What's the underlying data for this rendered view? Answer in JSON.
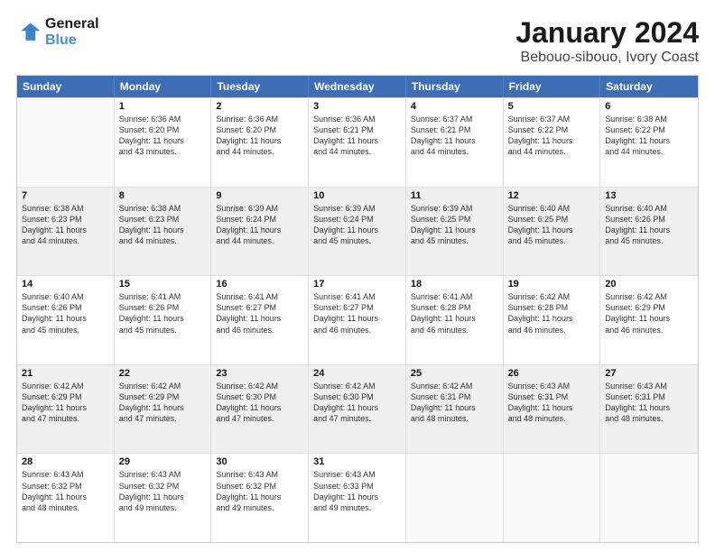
{
  "header": {
    "logo_line1": "General",
    "logo_line2": "Blue",
    "title": "January 2024",
    "subtitle": "Bebouo-sibouo, Ivory Coast"
  },
  "weekdays": [
    "Sunday",
    "Monday",
    "Tuesday",
    "Wednesday",
    "Thursday",
    "Friday",
    "Saturday"
  ],
  "weeks": [
    [
      {
        "day": "",
        "info": "",
        "empty": true
      },
      {
        "day": "1",
        "info": "Sunrise: 6:36 AM\nSunset: 6:20 PM\nDaylight: 11 hours\nand 43 minutes."
      },
      {
        "day": "2",
        "info": "Sunrise: 6:36 AM\nSunset: 6:20 PM\nDaylight: 11 hours\nand 44 minutes."
      },
      {
        "day": "3",
        "info": "Sunrise: 6:36 AM\nSunset: 6:21 PM\nDaylight: 11 hours\nand 44 minutes."
      },
      {
        "day": "4",
        "info": "Sunrise: 6:37 AM\nSunset: 6:21 PM\nDaylight: 11 hours\nand 44 minutes."
      },
      {
        "day": "5",
        "info": "Sunrise: 6:37 AM\nSunset: 6:22 PM\nDaylight: 11 hours\nand 44 minutes."
      },
      {
        "day": "6",
        "info": "Sunrise: 6:38 AM\nSunset: 6:22 PM\nDaylight: 11 hours\nand 44 minutes."
      }
    ],
    [
      {
        "day": "7",
        "info": "Sunrise: 6:38 AM\nSunset: 6:23 PM\nDaylight: 11 hours\nand 44 minutes."
      },
      {
        "day": "8",
        "info": "Sunrise: 6:38 AM\nSunset: 6:23 PM\nDaylight: 11 hours\nand 44 minutes."
      },
      {
        "day": "9",
        "info": "Sunrise: 6:39 AM\nSunset: 6:24 PM\nDaylight: 11 hours\nand 44 minutes."
      },
      {
        "day": "10",
        "info": "Sunrise: 6:39 AM\nSunset: 6:24 PM\nDaylight: 11 hours\nand 45 minutes."
      },
      {
        "day": "11",
        "info": "Sunrise: 6:39 AM\nSunset: 6:25 PM\nDaylight: 11 hours\nand 45 minutes."
      },
      {
        "day": "12",
        "info": "Sunrise: 6:40 AM\nSunset: 6:25 PM\nDaylight: 11 hours\nand 45 minutes."
      },
      {
        "day": "13",
        "info": "Sunrise: 6:40 AM\nSunset: 6:26 PM\nDaylight: 11 hours\nand 45 minutes."
      }
    ],
    [
      {
        "day": "14",
        "info": "Sunrise: 6:40 AM\nSunset: 6:26 PM\nDaylight: 11 hours\nand 45 minutes."
      },
      {
        "day": "15",
        "info": "Sunrise: 6:41 AM\nSunset: 6:26 PM\nDaylight: 11 hours\nand 45 minutes."
      },
      {
        "day": "16",
        "info": "Sunrise: 6:41 AM\nSunset: 6:27 PM\nDaylight: 11 hours\nand 46 minutes."
      },
      {
        "day": "17",
        "info": "Sunrise: 6:41 AM\nSunset: 6:27 PM\nDaylight: 11 hours\nand 46 minutes."
      },
      {
        "day": "18",
        "info": "Sunrise: 6:41 AM\nSunset: 6:28 PM\nDaylight: 11 hours\nand 46 minutes."
      },
      {
        "day": "19",
        "info": "Sunrise: 6:42 AM\nSunset: 6:28 PM\nDaylight: 11 hours\nand 46 minutes."
      },
      {
        "day": "20",
        "info": "Sunrise: 6:42 AM\nSunset: 6:29 PM\nDaylight: 11 hours\nand 46 minutes."
      }
    ],
    [
      {
        "day": "21",
        "info": "Sunrise: 6:42 AM\nSunset: 6:29 PM\nDaylight: 11 hours\nand 47 minutes."
      },
      {
        "day": "22",
        "info": "Sunrise: 6:42 AM\nSunset: 6:29 PM\nDaylight: 11 hours\nand 47 minutes."
      },
      {
        "day": "23",
        "info": "Sunrise: 6:42 AM\nSunset: 6:30 PM\nDaylight: 11 hours\nand 47 minutes."
      },
      {
        "day": "24",
        "info": "Sunrise: 6:42 AM\nSunset: 6:30 PM\nDaylight: 11 hours\nand 47 minutes."
      },
      {
        "day": "25",
        "info": "Sunrise: 6:42 AM\nSunset: 6:31 PM\nDaylight: 11 hours\nand 48 minutes."
      },
      {
        "day": "26",
        "info": "Sunrise: 6:43 AM\nSunset: 6:31 PM\nDaylight: 11 hours\nand 48 minutes."
      },
      {
        "day": "27",
        "info": "Sunrise: 6:43 AM\nSunset: 6:31 PM\nDaylight: 11 hours\nand 48 minutes."
      }
    ],
    [
      {
        "day": "28",
        "info": "Sunrise: 6:43 AM\nSunset: 6:32 PM\nDaylight: 11 hours\nand 48 minutes."
      },
      {
        "day": "29",
        "info": "Sunrise: 6:43 AM\nSunset: 6:32 PM\nDaylight: 11 hours\nand 49 minutes."
      },
      {
        "day": "30",
        "info": "Sunrise: 6:43 AM\nSunset: 6:32 PM\nDaylight: 11 hours\nand 49 minutes."
      },
      {
        "day": "31",
        "info": "Sunrise: 6:43 AM\nSunset: 6:33 PM\nDaylight: 11 hours\nand 49 minutes."
      },
      {
        "day": "",
        "info": "",
        "empty": true
      },
      {
        "day": "",
        "info": "",
        "empty": true
      },
      {
        "day": "",
        "info": "",
        "empty": true
      }
    ]
  ]
}
